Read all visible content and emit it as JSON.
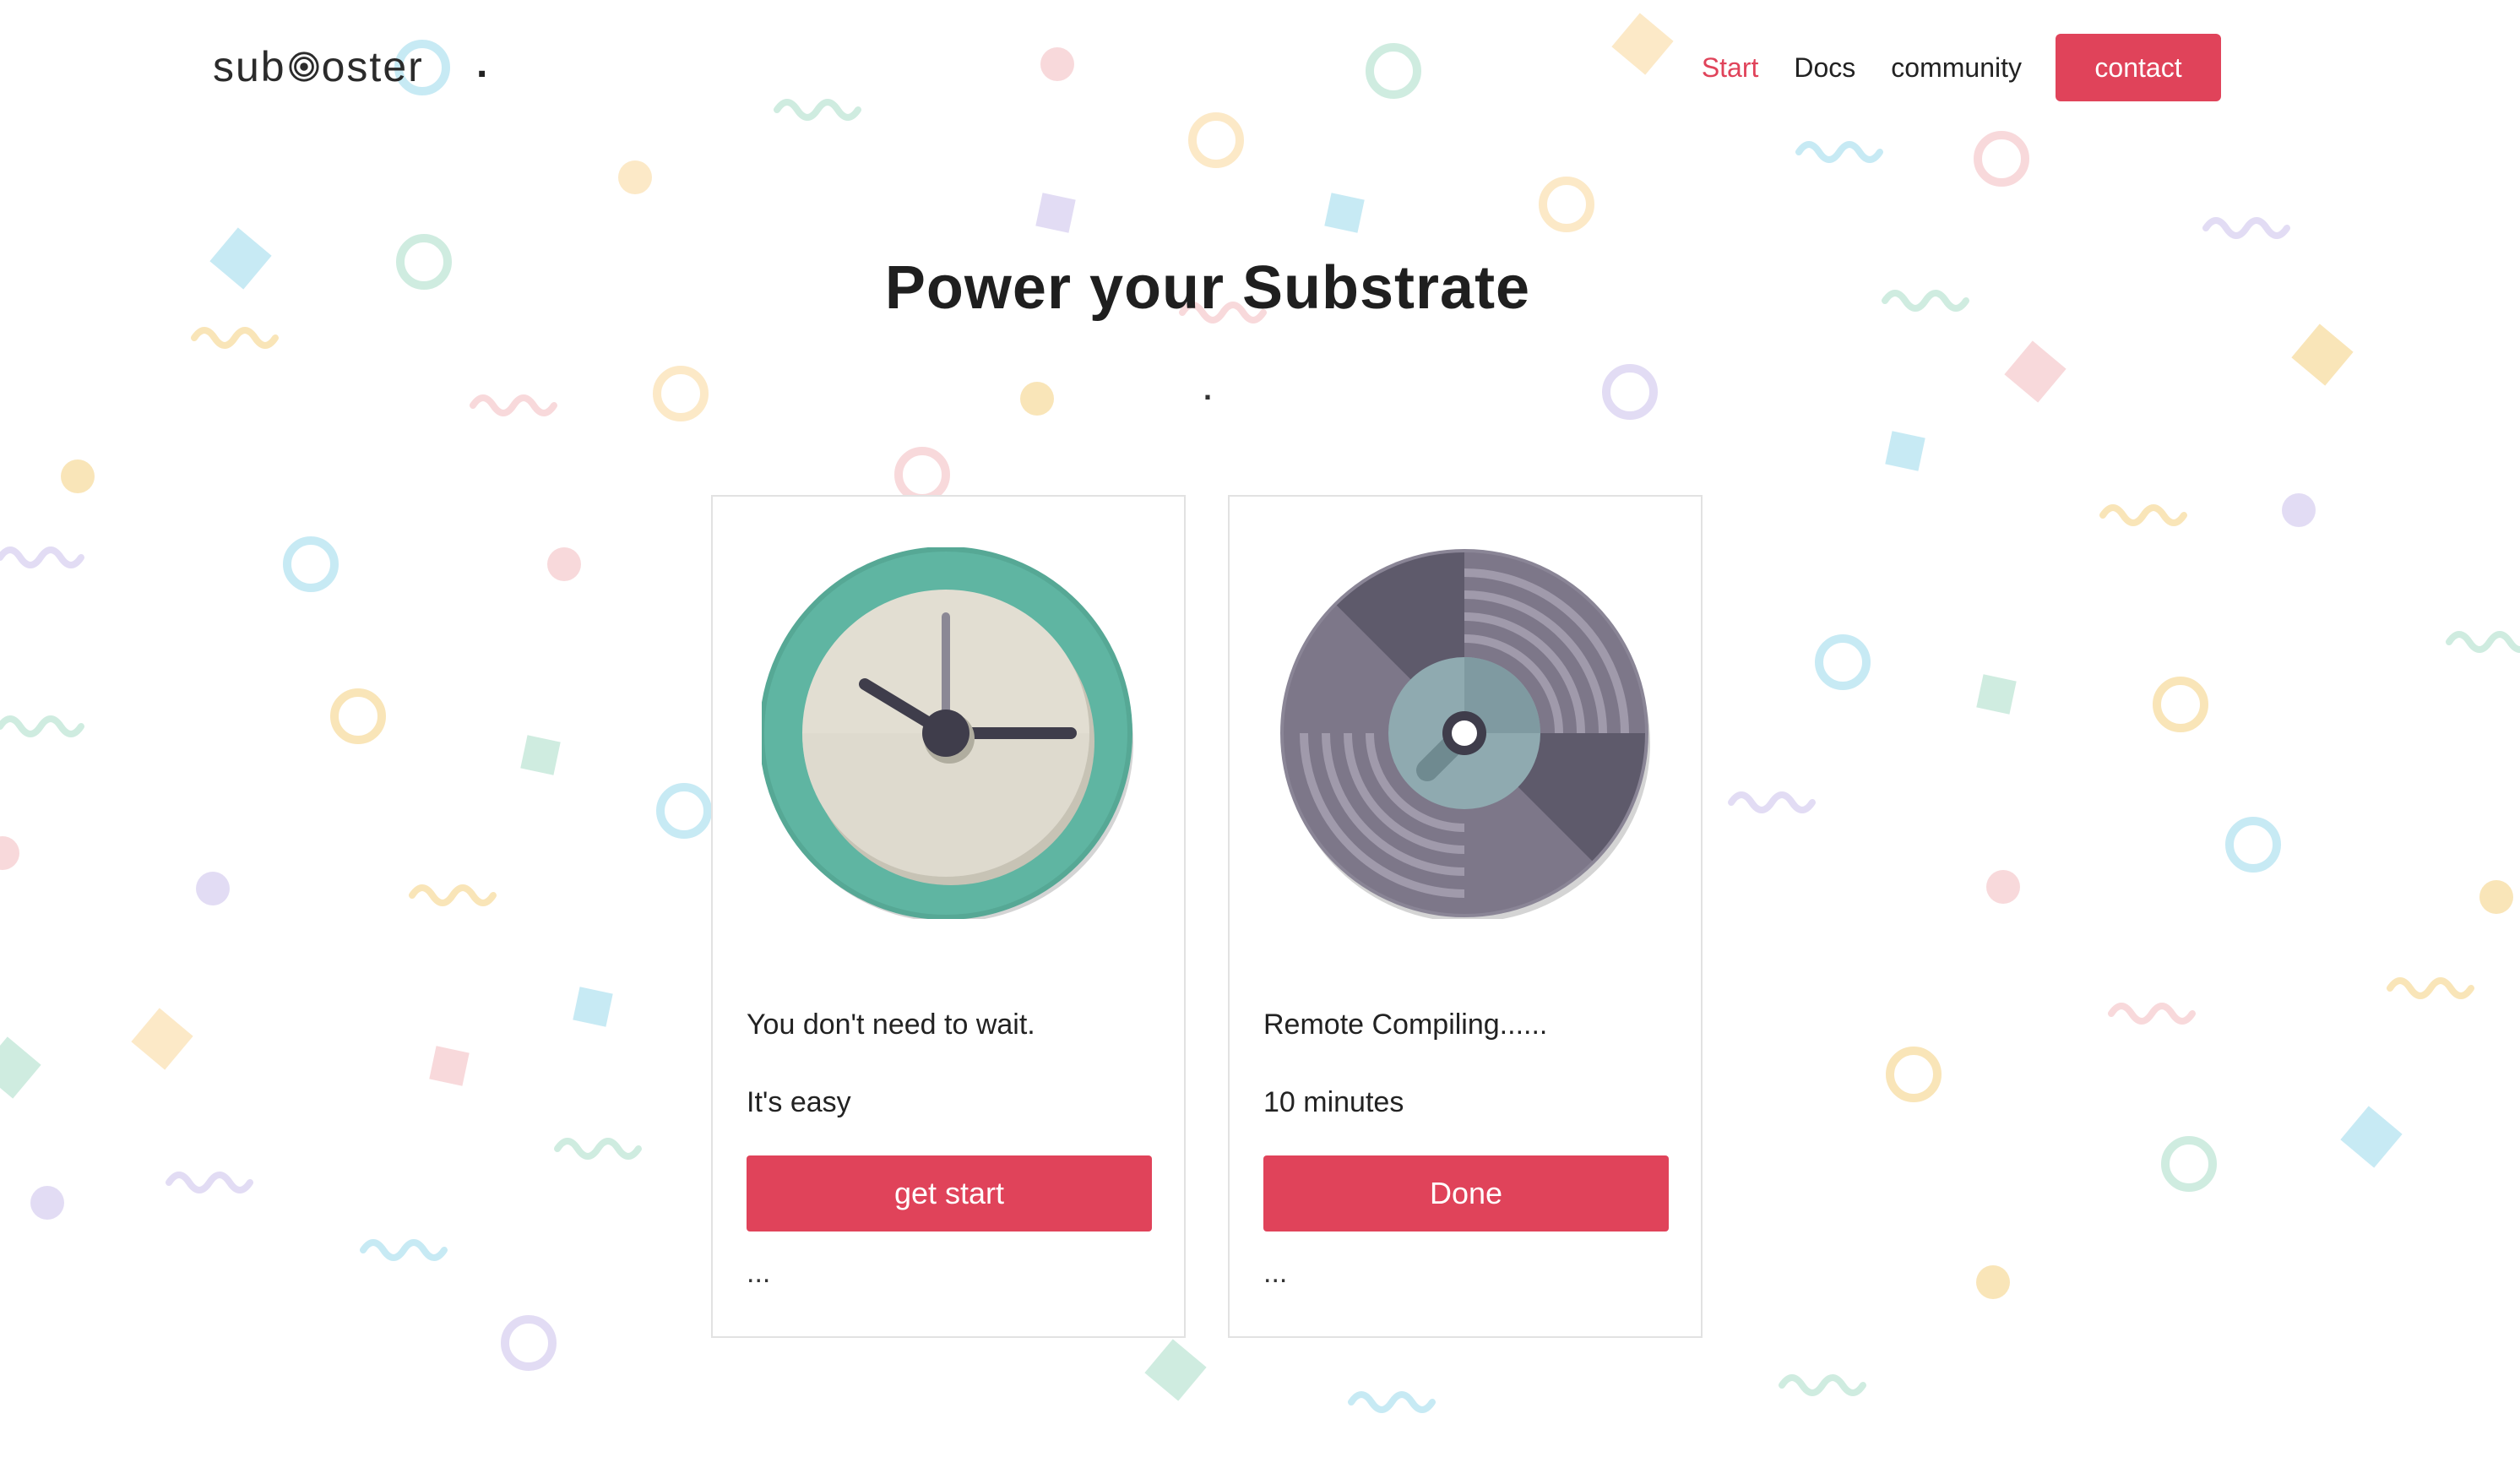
{
  "header": {
    "logo_text_left": "sub",
    "logo_text_right": "oster",
    "logo_dot": ".",
    "nav": [
      {
        "label": "Start",
        "active": true
      },
      {
        "label": "Docs",
        "active": false
      },
      {
        "label": "community",
        "active": false
      }
    ],
    "contact_label": "contact"
  },
  "hero": {
    "title": "Power your Substrate",
    "subtitle": "."
  },
  "cards": [
    {
      "icon": "clock-icon",
      "line1": "You don't need to wait.",
      "line2": "It's easy",
      "button": "get start",
      "more": "..."
    },
    {
      "icon": "vinyl-record-icon",
      "line1": "Remote Compiling......",
      "line2": "10 minutes",
      "button": "Done",
      "more": "..."
    }
  ],
  "colors": {
    "accent": "#e0435a",
    "clock_ring": "#5fb5a2",
    "clock_face": "#e2ded2",
    "record_dark": "#5e5a6b",
    "record_light": "#7d7789",
    "record_center": "#8faab0"
  },
  "confetti_colors": [
    "#b4e3f0",
    "#bfe6d6",
    "#f6cccf",
    "#fbe1b4",
    "#d8d0f0",
    "#f7dca0"
  ]
}
